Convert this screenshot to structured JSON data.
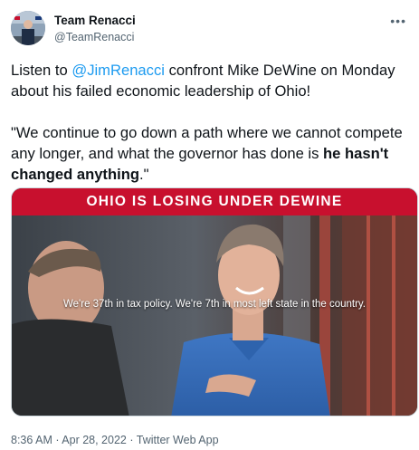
{
  "author": {
    "name": "Team Renacci",
    "handle": "@TeamRenacci"
  },
  "tweet": {
    "p1_before": "Listen to ",
    "p1_mention": "@JimRenacci",
    "p1_after": " confront Mike DeWine on Monday about his failed economic leadership of Ohio!",
    "p2_before": "\"We continue to go down a path where we cannot compete any longer, and what the governor has done is ",
    "p2_bold": "he hasn't changed anything",
    "p2_after": ".\""
  },
  "media": {
    "banner": "OHIO IS LOSING UNDER DEWINE",
    "caption": "We're 37th in tax policy. We're 7th in most left state in the country."
  },
  "meta": {
    "time": "8:36 AM · Apr 28, 2022",
    "separator": " · ",
    "source": "Twitter Web App"
  },
  "icons": {
    "more": "more-dots-icon"
  },
  "colors": {
    "link": "#1d9bf0",
    "banner": "#c8102e",
    "secondary_text": "#536471"
  }
}
